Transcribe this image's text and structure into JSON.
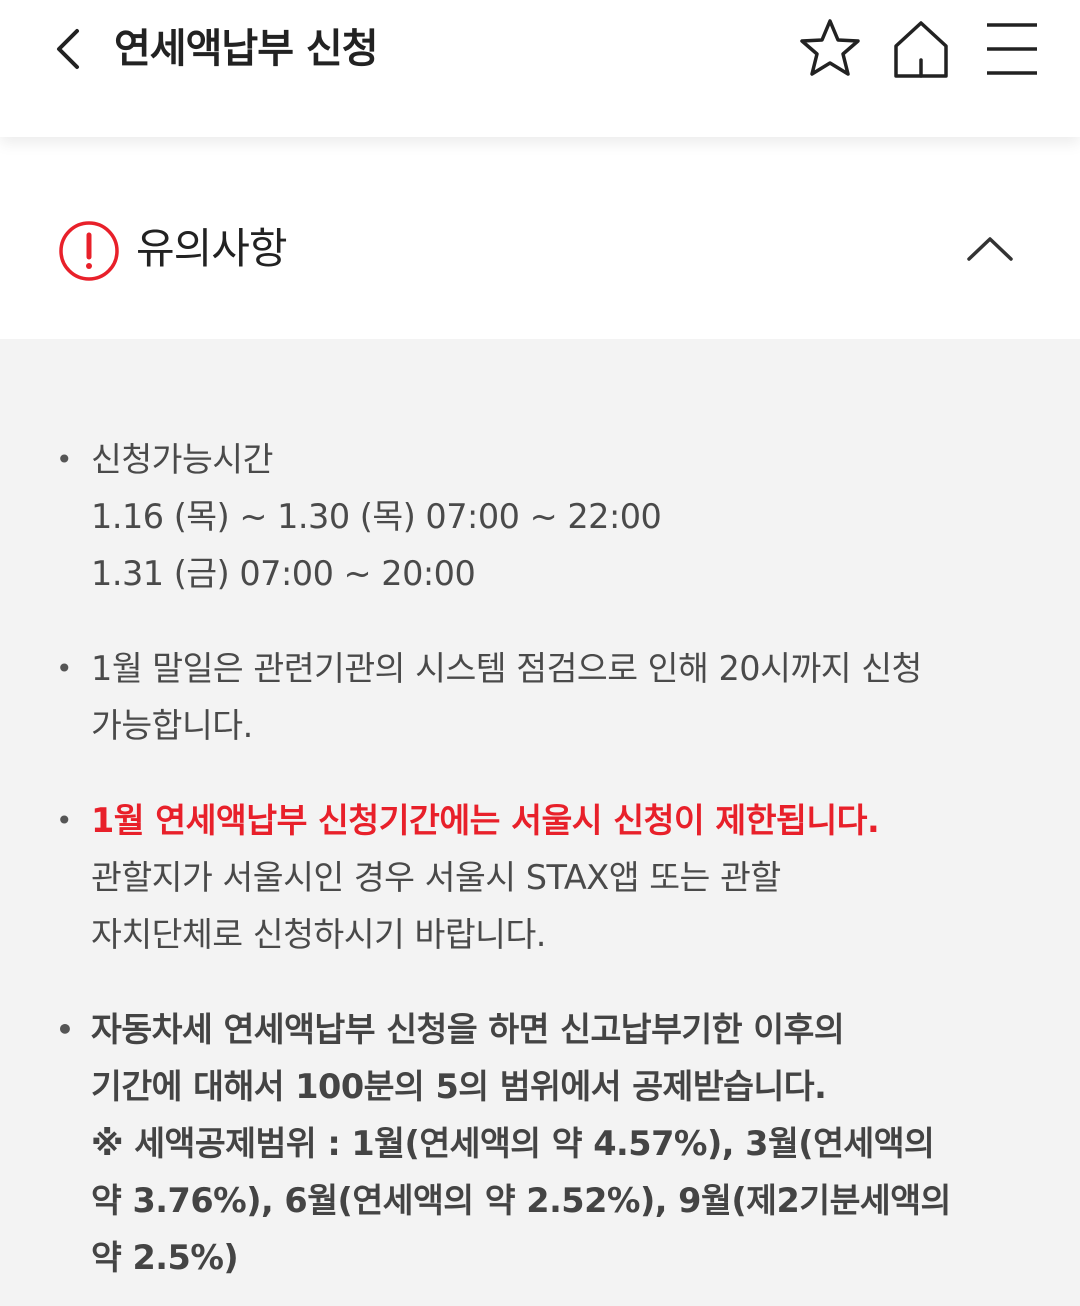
{
  "header": {
    "title": "연세액납부 신청",
    "icons": [
      "chevron-left-icon",
      "star-icon",
      "home-icon",
      "menu-icon"
    ]
  },
  "notice": {
    "title": "유의사항",
    "icons": [
      "alert-circle-icon",
      "chevron-up-icon"
    ],
    "items": [
      {
        "lines": [
          "신청가능시간",
          "1.16 (목) ~ 1.30 (목) 07:00 ~ 22:00",
          "1.31 (금) 07:00 ~ 20:00"
        ]
      },
      {
        "lines": [
          "1월 말일은 관련기관의 시스템 점검으로 인해 20시까지 신청",
          "가능합니다."
        ]
      },
      {
        "highlight": "1월 연세액납부 신청기간에는 서울시 신청이 제한됩니다.",
        "lines": [
          "관할지가 서울시인 경우 서울시 STAX앱 또는 관할",
          "자치단체로 신청하시기 바랍니다."
        ]
      },
      {
        "lines": [
          "자동차세 연세액납부 신청을 하면 신고납부기한 이후의",
          "기간에 대해서 100분의 5의 범위에서 공제받습니다.",
          "※ 세액공제범위 : 1월(연세액의 약 4.57%), 3월(연세액의",
          "약 3.76%), 6월(연세액의 약 2.52%), 9월(제2기분세액의",
          "약 2.5%)"
        ]
      }
    ]
  },
  "colors": {
    "accent_red": "#e8202a",
    "background": "#f3f3f3",
    "header_bg": "#ffffff"
  }
}
